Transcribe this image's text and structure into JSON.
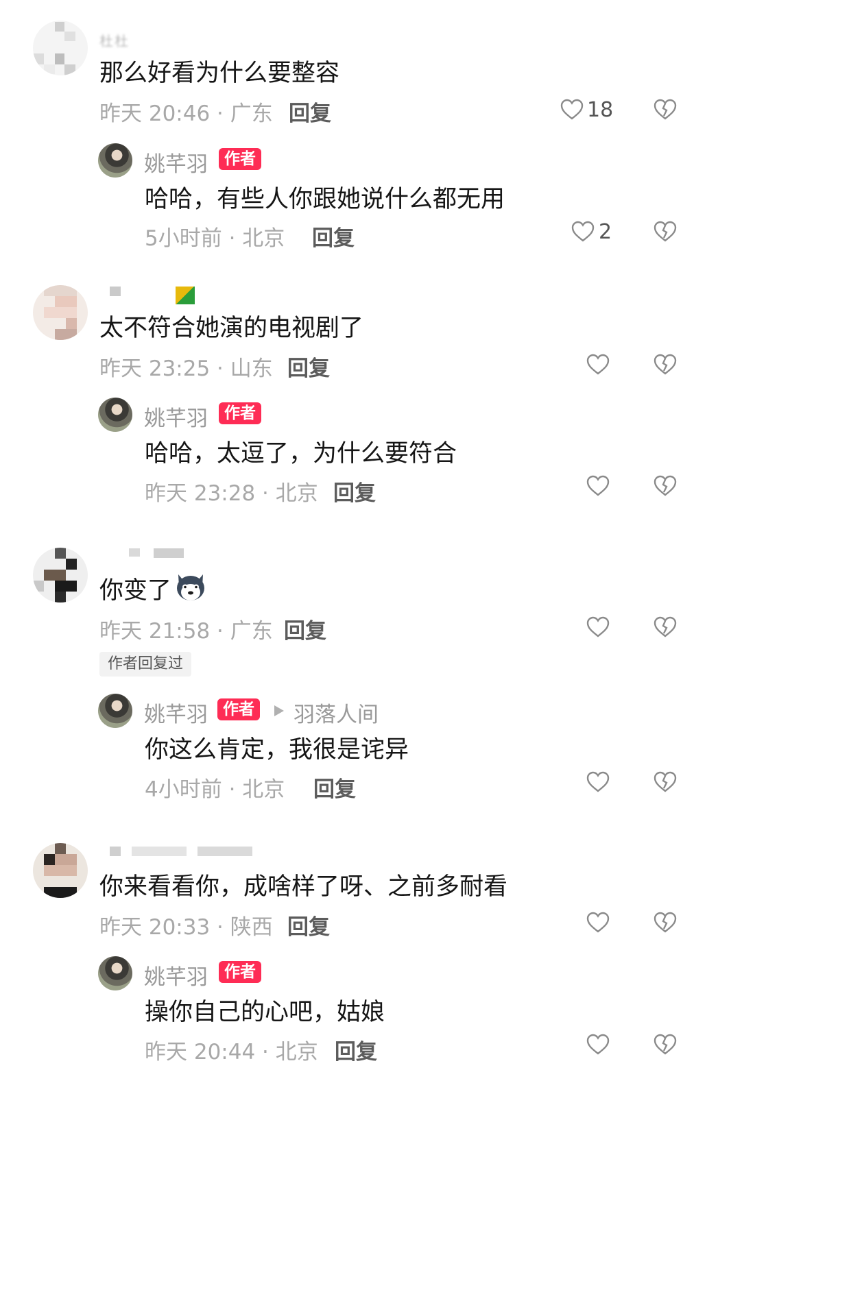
{
  "author": {
    "name": "姚芊羽",
    "badge": "作者"
  },
  "reply_label": "回复",
  "comments": [
    {
      "user_blurred": "杜杜",
      "text": "那么好看为什么要整容",
      "meta": "昨天 20:46 · 广东",
      "likes": "18",
      "reply": {
        "text": "哈哈，有些人你跟她说什么都无用",
        "meta": "5小时前 · 北京",
        "likes": "2"
      }
    },
    {
      "user_blurred": "",
      "text": "太不符合她演的电视剧了",
      "meta": "昨天 23:25 · 山东",
      "likes": "",
      "reply": {
        "text": "哈哈，太逗了，为什么要符合",
        "meta": "昨天 23:28 · 北京",
        "likes": ""
      }
    },
    {
      "user_blurred": "",
      "text": "你变了",
      "meta": "昨天 21:58 · 广东",
      "likes": "",
      "author_replied_tag": "作者回复过",
      "reply": {
        "reply_to": "羽落人间",
        "text": "你这么肯定，我很是诧异",
        "meta": "4小时前 · 北京",
        "likes": ""
      }
    },
    {
      "user_blurred": "",
      "text": "你来看看你，成啥样了呀、之前多耐看",
      "meta": "昨天 20:33 · 陕西",
      "likes": "",
      "reply": {
        "text": "操你自己的心吧，姑娘",
        "meta": "昨天 20:44 · 北京",
        "likes": ""
      }
    }
  ],
  "icons": {
    "like": "heart-outline-icon",
    "dislike": "broken-heart-icon",
    "emoji": "husky-dog-emoji"
  },
  "colors": {
    "author_badge": "#fe2c55",
    "meta_text": "#a8a8a8",
    "body_text": "#161616"
  }
}
